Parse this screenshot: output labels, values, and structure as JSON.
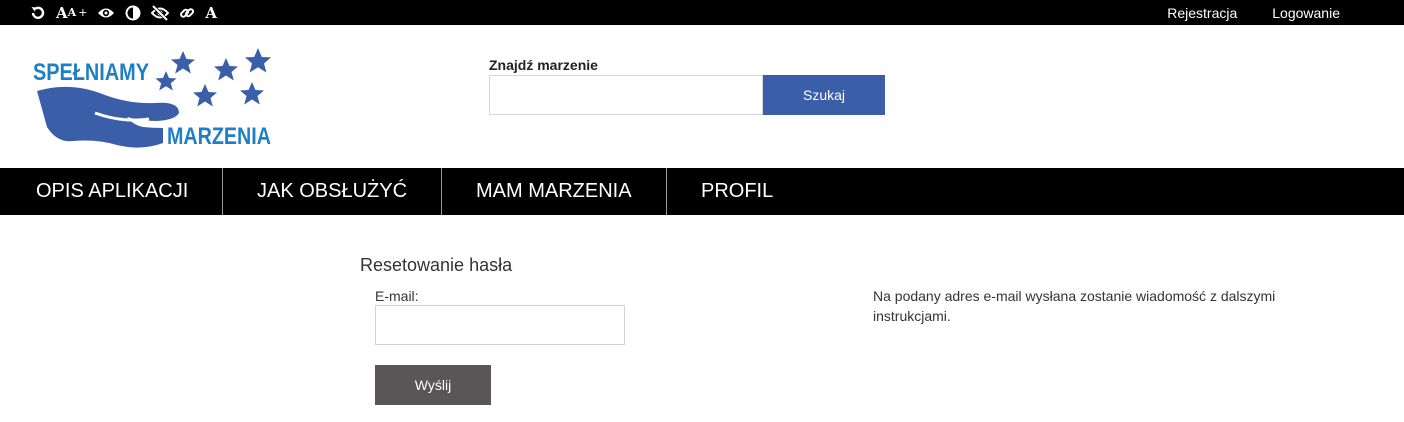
{
  "accessibility_toolbar": {
    "icons": [
      "reset-icon",
      "font-size-icon",
      "eye-icon",
      "contrast-icon",
      "eye-slash-icon",
      "link-icon",
      "font-icon"
    ],
    "font_size_label_big": "A",
    "font_size_label_small": "A",
    "font_size_plus": "+",
    "font_label": "A"
  },
  "top_links": {
    "register": "Rejestracja",
    "login": "Logowanie"
  },
  "logo": {
    "line1": "SPEŁNIAMY",
    "line2": "MARZENIA",
    "text_color": "#1f7fc4",
    "hand_color": "#3a5ea8"
  },
  "search": {
    "label": "Znajdź marzenie",
    "value": "",
    "placeholder": "",
    "button": "Szukaj"
  },
  "nav": {
    "items": [
      {
        "label": "OPIS APLIKACJI"
      },
      {
        "label": "JAK OBSŁUŻYĆ"
      },
      {
        "label": "MAM MARZENIA"
      },
      {
        "label": "PROFIL"
      }
    ]
  },
  "reset_form": {
    "title": "Resetowanie hasła",
    "email_label": "E-mail:",
    "email_value": "",
    "submit": "Wyślij",
    "info": "Na podany adres e-mail wysłana zostanie wiadomość z dalszymi instrukcjami."
  },
  "colors": {
    "bar_background": "#000000",
    "primary_button": "#3a5ea8",
    "submit_button": "#585656"
  }
}
